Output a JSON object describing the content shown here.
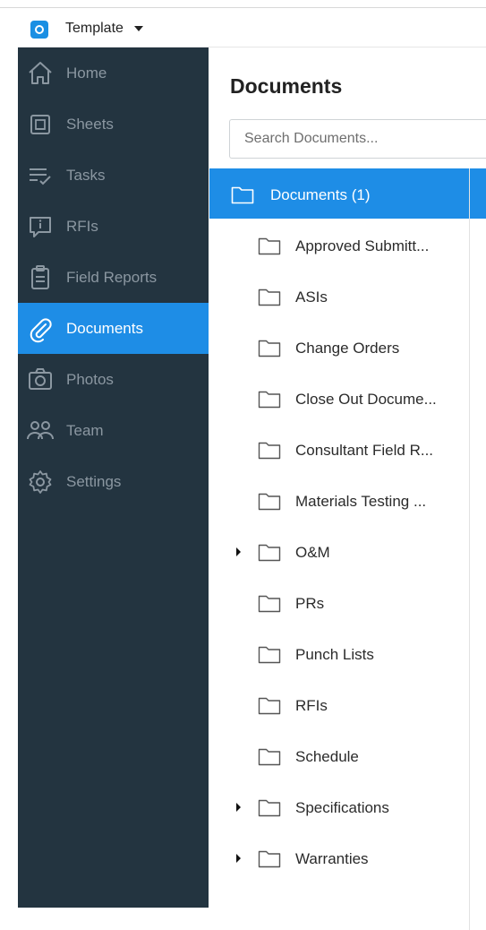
{
  "header": {
    "project_name": "Template",
    "logo_icon": "app-logo-icon",
    "dropdown_icon": "caret-down-icon"
  },
  "colors": {
    "sidebar_bg": "#233440",
    "accent": "#1e8de6",
    "sidebar_text": "#8b97a1",
    "active_text": "#ffffff"
  },
  "sidebar": {
    "items": [
      {
        "label": "Home",
        "icon": "home-icon",
        "active": false
      },
      {
        "label": "Sheets",
        "icon": "sheets-icon",
        "active": false
      },
      {
        "label": "Tasks",
        "icon": "tasks-icon",
        "active": false
      },
      {
        "label": "RFIs",
        "icon": "rfi-icon",
        "active": false
      },
      {
        "label": "Field Reports",
        "icon": "clipboard-icon",
        "active": false
      },
      {
        "label": "Documents",
        "icon": "paperclip-icon",
        "active": true
      },
      {
        "label": "Photos",
        "icon": "camera-icon",
        "active": false
      },
      {
        "label": "Team",
        "icon": "team-icon",
        "active": false
      },
      {
        "label": "Settings",
        "icon": "gear-icon",
        "active": false
      }
    ]
  },
  "main": {
    "title": "Documents",
    "search": {
      "placeholder": "Search Documents...",
      "value": ""
    },
    "tree": {
      "root": {
        "label": "Documents (1)",
        "icon": "folder-icon",
        "selected": true
      },
      "items": [
        {
          "label": "Approved Submitt...",
          "expandable": false
        },
        {
          "label": "ASIs",
          "expandable": false
        },
        {
          "label": "Change Orders",
          "expandable": false
        },
        {
          "label": "Close Out Docume...",
          "expandable": false
        },
        {
          "label": "Consultant Field R...",
          "expandable": false
        },
        {
          "label": "Materials Testing ...",
          "expandable": false
        },
        {
          "label": "O&M",
          "expandable": true
        },
        {
          "label": "PRs",
          "expandable": false
        },
        {
          "label": "Punch Lists",
          "expandable": false
        },
        {
          "label": "RFIs",
          "expandable": false
        },
        {
          "label": "Schedule",
          "expandable": false
        },
        {
          "label": "Specifications",
          "expandable": true
        },
        {
          "label": "Warranties",
          "expandable": true
        }
      ]
    }
  }
}
